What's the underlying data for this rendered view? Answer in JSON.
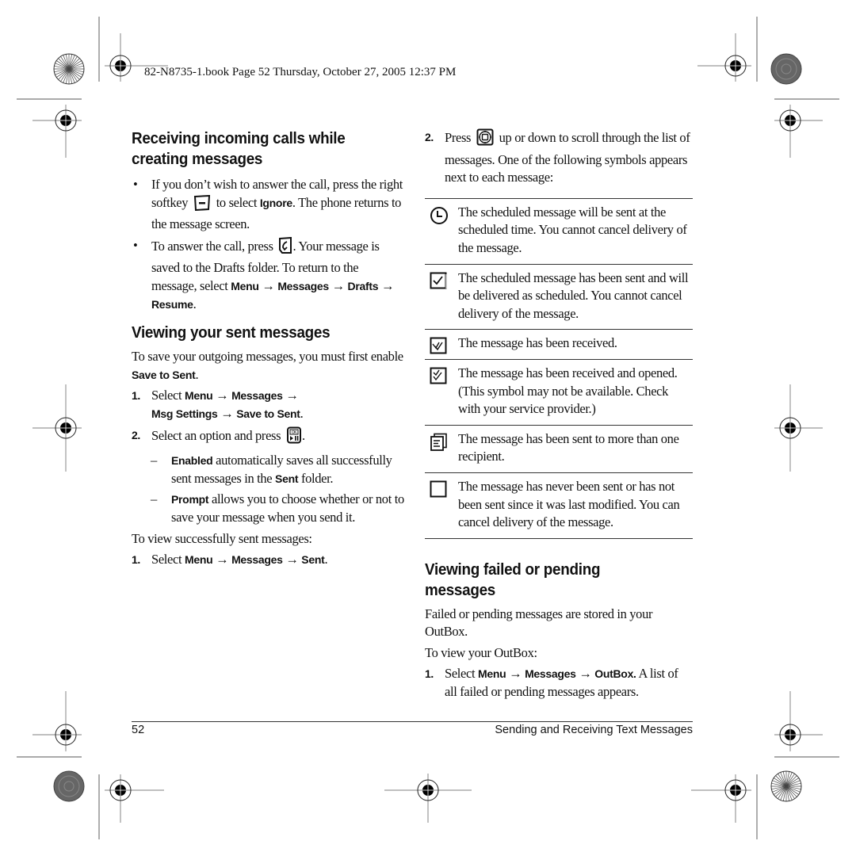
{
  "print_header": "82-N8735-1.book  Page 52  Thursday, October 27, 2005  12:37 PM",
  "left_column": {
    "section1": {
      "title_line1": "Receiving incoming calls while",
      "title_line2": "creating messages",
      "bullets": [
        {
          "marker": "•",
          "parts": {
            "a": "If you don’t wish to answer the call, press the right softkey",
            "icon": "right-softkey-icon",
            "b": "to select",
            "ui": "Ignore",
            "c": ". The phone returns to the message screen."
          }
        },
        {
          "marker": "•",
          "parts": {
            "a": "To answer the call, press",
            "icon": "send-talk-key-icon",
            "b": ". Your message is saved to the Drafts folder. To return to the message, select",
            "ui1": "Menu",
            "arrow1": " → ",
            "ui2": "Messages",
            "arrow2": " → ",
            "ui3": "Drafts",
            "arrow3": " → ",
            "ui4": "Resume",
            "end": "."
          }
        }
      ]
    },
    "section2": {
      "title": "Viewing your sent messages",
      "intro_a": "To save your outgoing messages, you must first enable",
      "intro_ui": "Save to Sent",
      "intro_end": ".",
      "steps": [
        {
          "marker": "1.",
          "text": "Select",
          "ui1": "Menu",
          "arrow1": " → ",
          "ui2": "Messages",
          "arrow2": " → ",
          "ui3": "Msg Settings",
          "arrow3": " → ",
          "ui4": "Save to Sent",
          "end": "."
        },
        {
          "marker": "2.",
          "text": "Select an option and press",
          "icon": "ok-key-icon",
          "end": "."
        }
      ],
      "options": [
        {
          "marker": "–",
          "ui": "Enabled",
          "text": " automatically saves all successfully sent messages in the ",
          "ui2": "Sent",
          "end": " folder."
        },
        {
          "marker": "–",
          "ui": "Prompt",
          "text": " allows you to choose whether or not to save your message when you send it."
        }
      ],
      "view_intro": "To view successfully sent messages:",
      "view_step": {
        "marker": "1.",
        "text": "Select",
        "ui1": "Menu",
        "arrow1": " → ",
        "ui2": "Messages",
        "arrow2": " → ",
        "ui3": "Sent",
        "end": "."
      }
    }
  },
  "right_column": {
    "step2": {
      "marker": "2.",
      "a": "Press",
      "icon": "navigation-key-icon",
      "b": "up or down to scroll through the list of messages. One of the following symbols appears next to each message:"
    },
    "symbols": [
      {
        "icon": "clock-icon",
        "text": "The scheduled message will be sent at the scheduled time. You cannot cancel delivery of the message."
      },
      {
        "icon": "checkbox-sent-icon",
        "text": "The scheduled message has been sent and will be delivered as scheduled. You cannot cancel delivery of the message."
      },
      {
        "icon": "checkbox-received-icon",
        "text": "The message has been received."
      },
      {
        "icon": "checkbox-opened-icon",
        "text": "The message has been received and opened. (This symbol may not be available. Check with your service provider.)"
      },
      {
        "icon": "multiple-recipients-icon",
        "text": "The message has been sent to more than one recipient."
      },
      {
        "icon": "empty-box-icon",
        "text": "The message has never been sent or has not been sent since it was last modified. You can cancel delivery of the message."
      }
    ],
    "section3": {
      "title": "Viewing failed or pending messages",
      "intro": "Failed or pending messages are stored in your OutBox.",
      "view_intro": "To view your OutBox:",
      "step": {
        "marker": "1.",
        "text": "Select",
        "ui1": "Menu",
        "arrow1": " → ",
        "ui2": "Messages",
        "arrow2": " → ",
        "ui3": "OutBox.",
        "end": " A list of all failed or pending messages appears."
      }
    }
  },
  "footer": {
    "page_number": "52",
    "chapter_title": "Sending and Receiving Text Messages"
  }
}
